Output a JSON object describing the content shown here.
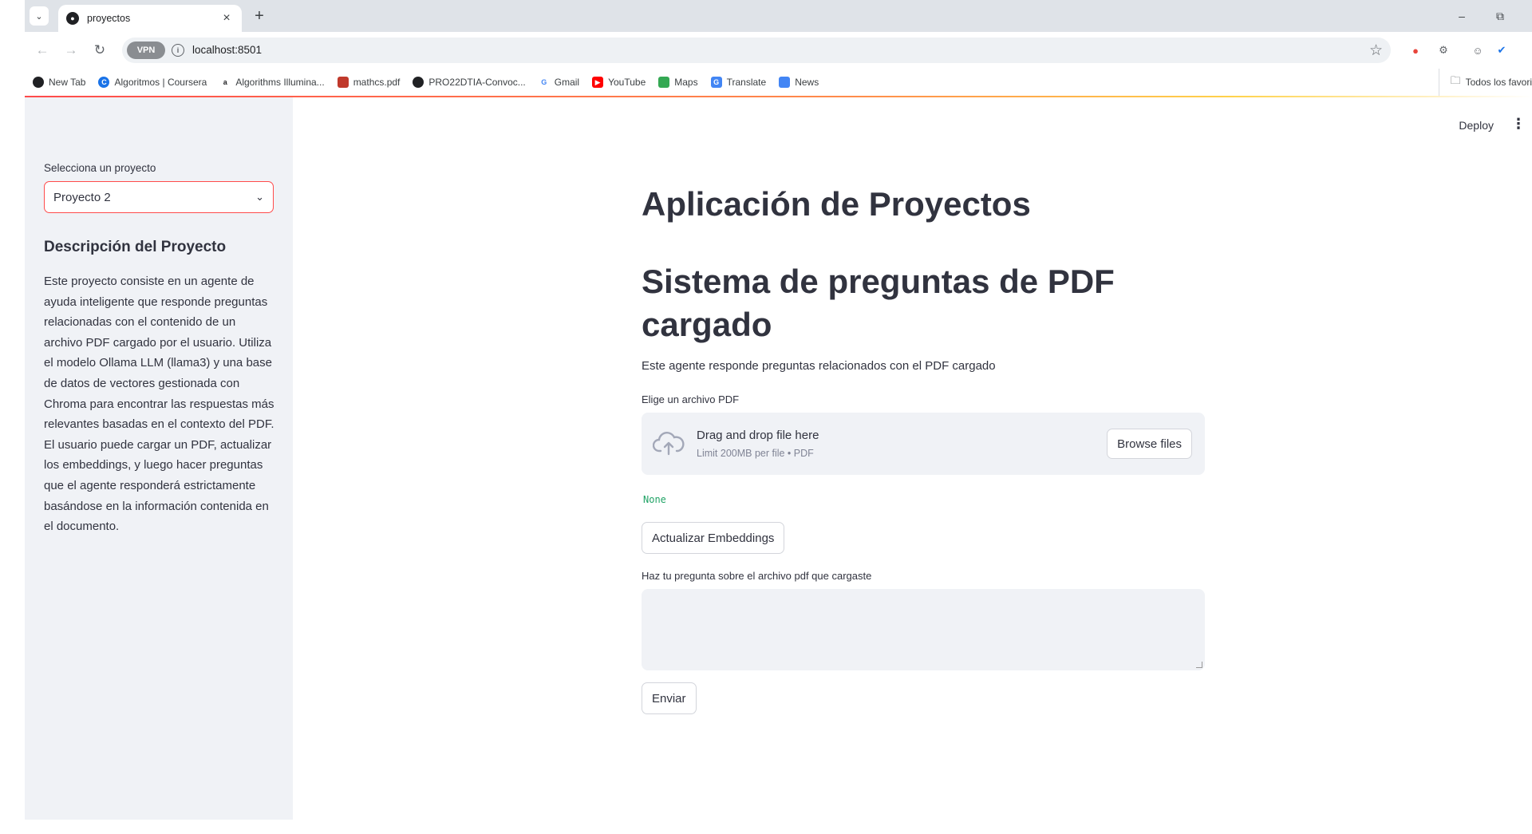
{
  "browser": {
    "tab_title": "proyectos",
    "url": "localhost:8501",
    "vpn_label": "VPN",
    "bookmarks": [
      {
        "label": "New Tab",
        "color": "#202124"
      },
      {
        "label": "Algoritmos | Coursera",
        "color": "#1a73e8"
      },
      {
        "label": "Algorithms Illumina...",
        "color": "#202124"
      },
      {
        "label": "mathcs.pdf",
        "color": "#c0392b"
      },
      {
        "label": "PRO22DTIA-Convoc...",
        "color": "#202124"
      },
      {
        "label": "Gmail",
        "color": "#4285f4"
      },
      {
        "label": "YouTube",
        "color": "#ff0000"
      },
      {
        "label": "Maps",
        "color": "#34a853"
      },
      {
        "label": "Translate",
        "color": "#4285f4"
      },
      {
        "label": "News",
        "color": "#4285f4"
      }
    ],
    "bookmarks_folder": "Todos los favori"
  },
  "header": {
    "deploy_label": "Deploy"
  },
  "sidebar": {
    "select_label": "Selecciona un proyecto",
    "select_value": "Proyecto 2",
    "heading": "Descripción del Proyecto",
    "description": "Este proyecto consiste en un agente de ayuda inteligente que responde preguntas relacionadas con el contenido de un archivo PDF cargado por el usuario. Utiliza el modelo Ollama LLM (llama3) y una base de datos de vectores gestionada con Chroma para encontrar las respuestas más relevantes basadas en el contexto del PDF. El usuario puede cargar un PDF, actualizar los embeddings, y luego hacer preguntas que el agente responderá estrictamente basándose en la información contenida en el documento."
  },
  "main": {
    "title": "Aplicación de Proyectos",
    "subtitle": "Sistema de preguntas de PDF cargado",
    "caption": "Este agente responde preguntas relacionados con el PDF cargado",
    "uploader": {
      "label": "Elige un archivo PDF",
      "drop_text": "Drag and drop file here",
      "limit_text": "Limit 200MB per file • PDF",
      "browse_label": "Browse files"
    },
    "status_value": "None",
    "update_button": "Actualizar Embeddings",
    "question_label": "Haz tu pregunta sobre el archivo pdf que cargaste",
    "question_value": "",
    "send_button": "Enviar"
  },
  "colors": {
    "accent": "#ff4b4b",
    "sidebar_bg": "#f0f2f6",
    "text": "#31333f",
    "none_tag": "#21a366"
  }
}
